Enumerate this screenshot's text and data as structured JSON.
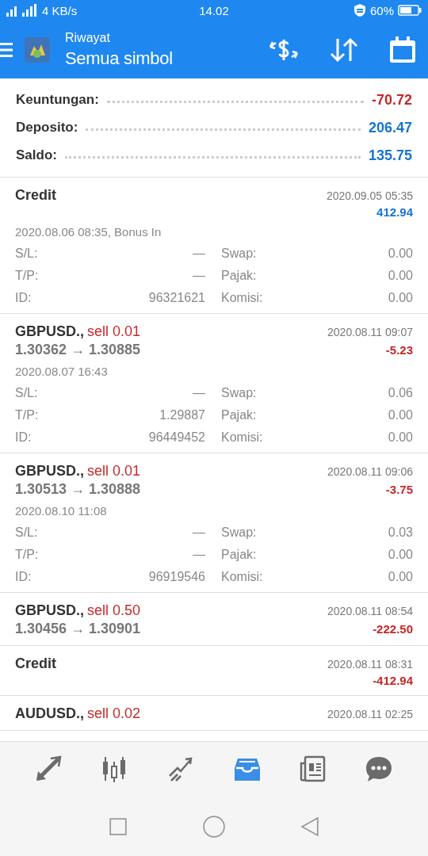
{
  "status_bar": {
    "network": "4 KB/s",
    "time": "14.02",
    "battery": "60%"
  },
  "header": {
    "subtitle": "Riwayat",
    "title": "Semua simbol"
  },
  "summary": [
    {
      "label": "Keuntungan:",
      "value": "-70.72",
      "color": "#c62828"
    },
    {
      "label": "Deposito:",
      "value": "206.47",
      "color": "#1574d4"
    },
    {
      "label": "Saldo:",
      "value": "135.75",
      "color": "#1574d4"
    }
  ],
  "entries": [
    {
      "kind": "credit",
      "title": "Credit",
      "time": "2020.09.05 05:35",
      "amount": "412.94",
      "color": "#1574d4",
      "note": "2020.08.06 08:35, Bonus In",
      "details": [
        [
          {
            "label": "S/L:",
            "value": "—"
          },
          {
            "label": "Swap:",
            "value": "0.00"
          }
        ],
        [
          {
            "label": "T/P:",
            "value": "—"
          },
          {
            "label": "Pajak:",
            "value": "0.00"
          }
        ],
        [
          {
            "label": "ID:",
            "value": "96321621"
          },
          {
            "label": "Komisi:",
            "value": "0.00"
          }
        ]
      ]
    },
    {
      "kind": "trade",
      "title": "GBPUSD.,",
      "side": "sell 0.01",
      "time": "2020.08.11 09:07",
      "prices": "1.30362 → 1.30885",
      "amount": "-5.23",
      "color": "#c62828",
      "note": "2020.08.07 16:43",
      "details": [
        [
          {
            "label": "S/L:",
            "value": "—"
          },
          {
            "label": "Swap:",
            "value": "0.06"
          }
        ],
        [
          {
            "label": "T/P:",
            "value": "1.29887"
          },
          {
            "label": "Pajak:",
            "value": "0.00"
          }
        ],
        [
          {
            "label": "ID:",
            "value": "96449452"
          },
          {
            "label": "Komisi:",
            "value": "0.00"
          }
        ]
      ]
    },
    {
      "kind": "trade",
      "title": "GBPUSD.,",
      "side": "sell 0.01",
      "time": "2020.08.11 09:06",
      "prices": "1.30513 → 1.30888",
      "amount": "-3.75",
      "color": "#c62828",
      "note": "2020.08.10 11:08",
      "details": [
        [
          {
            "label": "S/L:",
            "value": "—"
          },
          {
            "label": "Swap:",
            "value": "0.03"
          }
        ],
        [
          {
            "label": "T/P:",
            "value": "—"
          },
          {
            "label": "Pajak:",
            "value": "0.00"
          }
        ],
        [
          {
            "label": "ID:",
            "value": "96919546"
          },
          {
            "label": "Komisi:",
            "value": "0.00"
          }
        ]
      ]
    },
    {
      "kind": "trade",
      "title": "GBPUSD.,",
      "side": "sell 0.50",
      "time": "2020.08.11 08:54",
      "prices": "1.30456 → 1.30901",
      "amount": "-222.50",
      "color": "#c62828"
    },
    {
      "kind": "credit",
      "title": "Credit",
      "time": "2020.08.11 08:31",
      "amount": "-412.94",
      "color": "#c62828"
    },
    {
      "kind": "trade",
      "title": "AUDUSD.,",
      "side": "sell 0.02",
      "time": "2020.08.11 02:25"
    }
  ],
  "bottom_tabs": [
    {
      "kind": "trade",
      "selected": false
    },
    {
      "kind": "quotes",
      "selected": false
    },
    {
      "kind": "chart",
      "selected": false
    },
    {
      "kind": "history",
      "selected": true
    },
    {
      "kind": "news",
      "selected": false
    },
    {
      "kind": "chat",
      "selected": false
    }
  ]
}
